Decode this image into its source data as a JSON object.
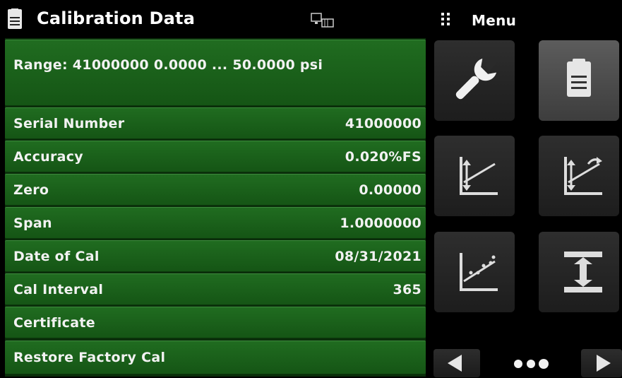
{
  "header": {
    "title": "Calibration Data",
    "menu_label": "Menu"
  },
  "range_row": {
    "label": "Range: 41000000   0.0000 ... 50.0000 psi"
  },
  "rows": [
    {
      "label": "Serial Number",
      "value": "41000000"
    },
    {
      "label": "Accuracy",
      "value": "0.020%FS"
    },
    {
      "label": "Zero",
      "value": "0.00000"
    },
    {
      "label": "Span",
      "value": "1.0000000"
    },
    {
      "label": "Date of Cal",
      "value": "08/31/2021"
    },
    {
      "label": "Cal Interval",
      "value": "365"
    },
    {
      "label": "Certificate",
      "value": ""
    },
    {
      "label": "Restore Factory Cal",
      "value": ""
    }
  ],
  "menu_tiles": [
    {
      "icon": "wrench-icon",
      "active": false
    },
    {
      "icon": "document-icon",
      "active": true
    },
    {
      "icon": "zero-calibration-icon",
      "active": false
    },
    {
      "icon": "span-calibration-icon",
      "active": false
    },
    {
      "icon": "linearity-calibration-icon",
      "active": false
    },
    {
      "icon": "range-adjust-icon",
      "active": false
    }
  ],
  "pager": {
    "page_dots": 3
  },
  "colors": {
    "row_green": "#1b611b",
    "panel_bg": "#0a2e0a",
    "tile_bg": "#262626",
    "tile_active_bg": "#4d4d4d"
  }
}
